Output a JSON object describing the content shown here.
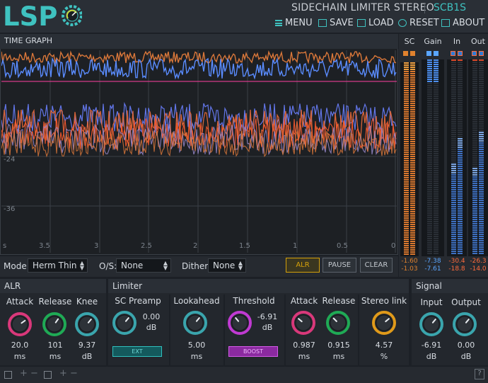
{
  "header": {
    "logo_text": "LSP",
    "plugin_title": "SIDECHAIN LIMITER STEREO",
    "plugin_code": "SCB1S",
    "menu": [
      {
        "label": "MENU",
        "icon": "menu-icon"
      },
      {
        "label": "SAVE",
        "icon": "save-icon"
      },
      {
        "label": "LOAD",
        "icon": "load-icon"
      },
      {
        "label": "RESET",
        "icon": "reset-icon"
      },
      {
        "label": "ABOUT",
        "icon": "about-icon"
      }
    ]
  },
  "graph": {
    "title": "TIME GRAPH",
    "y_labels": [
      "-24",
      "-36"
    ],
    "x_labels": [
      "s",
      "3.5",
      "3",
      "2.5",
      "2",
      "1.5",
      "1",
      "0.5",
      "0"
    ]
  },
  "meters": {
    "columns": [
      {
        "label": "SC",
        "values": [
          "-1.60",
          "-1.03"
        ],
        "color": "#e0822e"
      },
      {
        "label": "Gain",
        "values": [
          "-7.38",
          "-7.61"
        ],
        "color": "#5aa6ff"
      },
      {
        "label": "In",
        "values": [
          "-30.4",
          "-18.8"
        ],
        "color": "#ff6b3c"
      },
      {
        "label": "Out",
        "values": [
          "-26.3",
          "-14.0"
        ],
        "color": "#ff6b3c"
      }
    ]
  },
  "controls": {
    "mode_label": "Mode:",
    "mode_value": "Herm Thin",
    "os_label": "O/S:",
    "os_value": "None",
    "dither_label": "Dither:",
    "dither_value": "None",
    "buttons": {
      "alr": "ALR",
      "pause": "PAUSE",
      "clear": "CLEAR"
    }
  },
  "alr": {
    "title": "ALR",
    "knobs": [
      {
        "label": "Attack",
        "value": "20.0",
        "unit": "ms",
        "color": "#d9387a"
      },
      {
        "label": "Release",
        "value": "101",
        "unit": "ms",
        "color": "#1faa55"
      },
      {
        "label": "Knee",
        "value": "9.37",
        "unit": "dB",
        "color": "#3aa5ad"
      }
    ]
  },
  "limiter": {
    "title": "Limiter",
    "sc_preamp": {
      "label": "SC Preamp",
      "value": "0.00",
      "unit": "dB",
      "button": "EXT",
      "color": "#3aa5ad"
    },
    "lookahead": {
      "label": "Lookahead",
      "value": "5.00",
      "unit": "ms",
      "color": "#3aa5ad"
    },
    "threshold": {
      "label": "Threshold",
      "value": "-6.91",
      "unit": "dB",
      "button": "BOOST",
      "color": "#c03ad2"
    },
    "attack": {
      "label": "Attack",
      "value": "0.987",
      "unit": "ms",
      "color": "#d9387a"
    },
    "release": {
      "label": "Release",
      "value": "0.915",
      "unit": "ms",
      "color": "#1faa55"
    },
    "stereo_link": {
      "label": "Stereo link",
      "value": "4.57",
      "unit": "%",
      "color": "#e09a1a"
    }
  },
  "signal": {
    "title": "Signal",
    "input": {
      "label": "Input",
      "value": "-6.91",
      "unit": "dB",
      "color": "#3aa5ad"
    },
    "output": {
      "label": "Output",
      "value": "0.00",
      "unit": "dB",
      "color": "#3aa5ad"
    }
  },
  "footer": {
    "help": "?"
  }
}
